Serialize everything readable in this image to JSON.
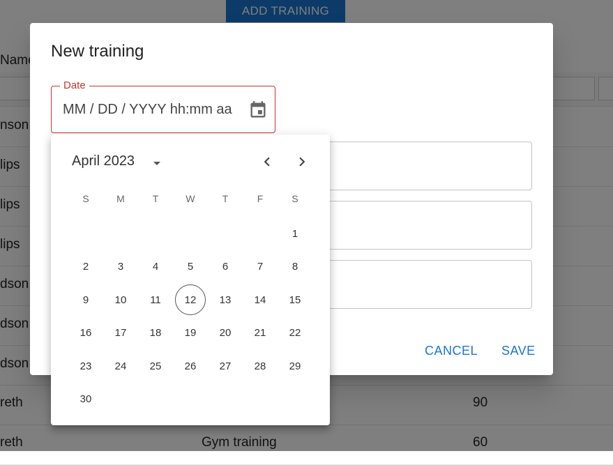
{
  "toolbar": {
    "add_label": "ADD TRAINING"
  },
  "table": {
    "name_header": "Name",
    "rows": [
      {
        "name": "nson"
      },
      {
        "name": "lips"
      },
      {
        "name": "lips"
      },
      {
        "name": "lips"
      },
      {
        "name": "dson"
      },
      {
        "name": "dson"
      },
      {
        "name": "dson"
      },
      {
        "name": "reth",
        "duration": "90"
      },
      {
        "name": "reth",
        "activity": "Gym training",
        "duration": "60"
      }
    ]
  },
  "dialog": {
    "title": "New training",
    "date_label": "Date",
    "date_placeholder": "MM / DD / YYYY hh:mm aa",
    "cancel_label": "CANCEL",
    "save_label": "SAVE"
  },
  "picker": {
    "month": "April 2023",
    "weekdays": [
      "S",
      "M",
      "T",
      "W",
      "T",
      "F",
      "S"
    ],
    "days": [
      "1",
      "2",
      "3",
      "4",
      "5",
      "6",
      "7",
      "8",
      "9",
      "10",
      "11",
      "12",
      "13",
      "14",
      "15",
      "16",
      "17",
      "18",
      "19",
      "20",
      "21",
      "22",
      "23",
      "24",
      "25",
      "26",
      "27",
      "28",
      "29",
      "30"
    ],
    "first_weekday": 6,
    "selected_day": "12"
  },
  "icons": {
    "calendar": "calendar-icon",
    "caret": "arrow-drop-down-icon",
    "prev": "chevron-left-icon",
    "next": "chevron-right-icon"
  },
  "colors": {
    "accent": "#1976d2",
    "error": "#d32f2f"
  }
}
